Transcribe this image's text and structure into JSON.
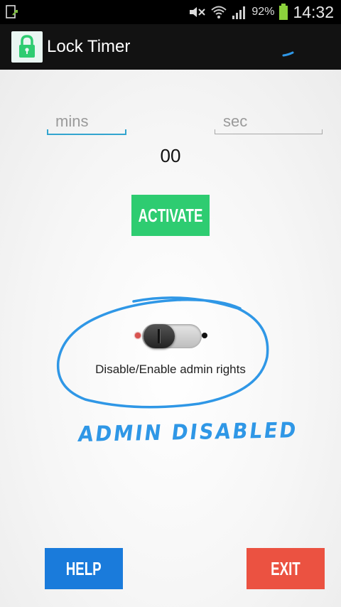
{
  "status_bar": {
    "battery_percent": "92%",
    "time": "14:32",
    "icons": [
      "notification-icon",
      "mute-icon",
      "wifi-icon",
      "signal-icon",
      "battery-icon"
    ]
  },
  "action_bar": {
    "title": "Lock Timer",
    "app_icon": "lock-icon"
  },
  "form": {
    "mins_placeholder": "mins",
    "sec_placeholder": "sec",
    "timer_value": "00"
  },
  "buttons": {
    "activate": "ACTIVATE",
    "help": "HELP",
    "exit": "EXIT"
  },
  "admin": {
    "toggle_state": "off",
    "label": "Disable/Enable admin rights",
    "annotation": "ADMIN DISABLED"
  },
  "colors": {
    "activate": "#2ecc71",
    "help": "#1a7bdb",
    "exit": "#eb5241",
    "annotation": "#2f97e6",
    "field_focus": "#33a5cf"
  }
}
